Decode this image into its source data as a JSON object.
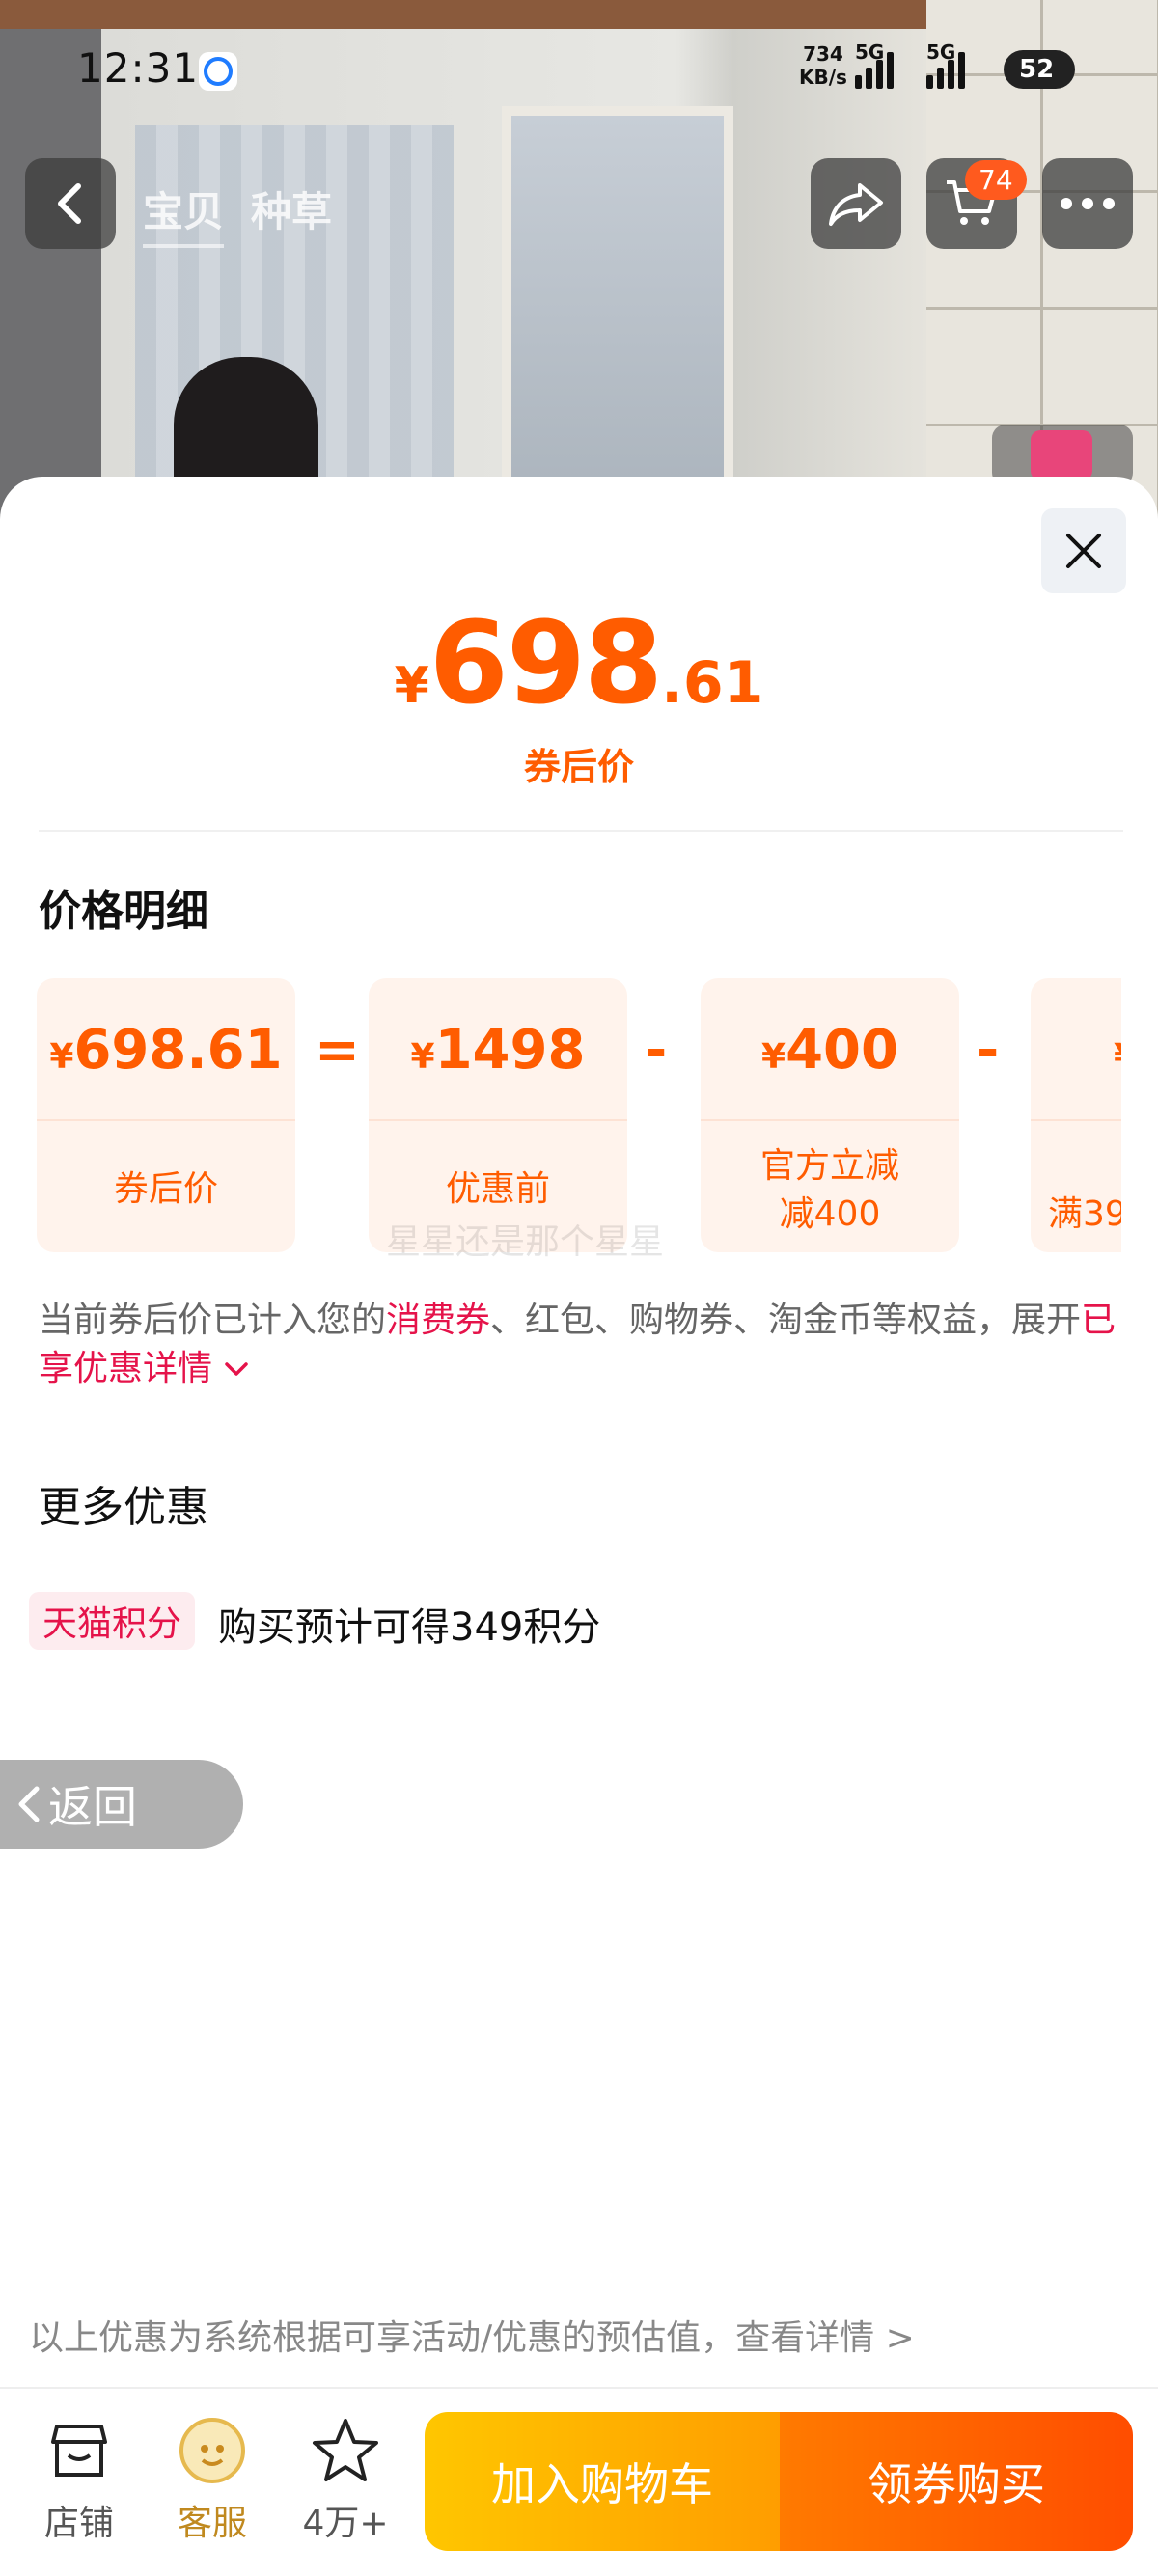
{
  "status_bar": {
    "time": "12:31",
    "net_speed_value": "734",
    "net_speed_unit": "KB/s",
    "signal1_label": "5G",
    "signal2_label": "5G",
    "battery": "52"
  },
  "top_nav": {
    "tabs": [
      "宝贝",
      "种草"
    ],
    "cart_count": "74"
  },
  "price_sheet": {
    "currency": "¥",
    "price_int": "698",
    "price_dec": ".61",
    "price_label": "券后价",
    "detail_title": "价格明细",
    "cards": [
      {
        "amount": "698.61",
        "label": "券后价"
      },
      {
        "amount": "1498",
        "label": "优惠前"
      },
      {
        "amount": "400",
        "label_line1": "官方立减",
        "label_line2": "减400"
      },
      {
        "amount": "",
        "label": "满39"
      }
    ],
    "ops": [
      "=",
      "-",
      "-"
    ],
    "watermark": "星星还是那个星星",
    "note_prefix": "当前券后价已计入您的",
    "note_highlight": "消费券",
    "note_middle": "、红包、购物券、淘金币等权益，展开",
    "note_link": "已享优惠详情",
    "more_title": "更多优惠",
    "tag": "天猫积分",
    "tag_text": "购买预计可得349积分",
    "back_label": "返回",
    "disclaimer": "以上优惠为系统根据可享活动/优惠的预估值，查看详情 >"
  },
  "bottom_bar": {
    "shop": "店铺",
    "service": "客服",
    "fav": "4万+",
    "add_cart": "加入购物车",
    "buy": "领券购买"
  },
  "colors": {
    "accent": "#ff5c00",
    "highlight": "#e5134a",
    "card_bg": "#fff3ec"
  }
}
